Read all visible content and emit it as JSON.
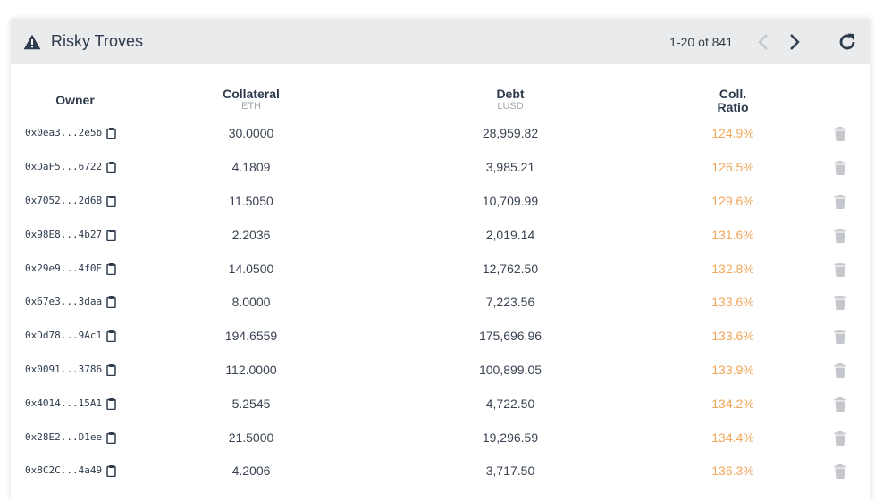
{
  "header": {
    "title": "Risky Troves",
    "pagination": "1-20 of 841"
  },
  "columns": {
    "owner": "Owner",
    "collateral": "Collateral",
    "collateral_unit": "ETH",
    "debt": "Debt",
    "debt_unit": "LUSD",
    "ratio_line1": "Coll.",
    "ratio_line2": "Ratio"
  },
  "rows": [
    {
      "owner": "0x0ea3...2e5b",
      "collateral": "30.0000",
      "debt": "28,959.82",
      "ratio": "124.9%"
    },
    {
      "owner": "0xDaF5...6722",
      "collateral": "4.1809",
      "debt": "3,985.21",
      "ratio": "126.5%"
    },
    {
      "owner": "0x7052...2d6B",
      "collateral": "11.5050",
      "debt": "10,709.99",
      "ratio": "129.6%"
    },
    {
      "owner": "0x98E8...4b27",
      "collateral": "2.2036",
      "debt": "2,019.14",
      "ratio": "131.6%"
    },
    {
      "owner": "0x29e9...4f0E",
      "collateral": "14.0500",
      "debt": "12,762.50",
      "ratio": "132.8%"
    },
    {
      "owner": "0x67e3...3daa",
      "collateral": "8.0000",
      "debt": "7,223.56",
      "ratio": "133.6%"
    },
    {
      "owner": "0xDd78...9Ac1",
      "collateral": "194.6559",
      "debt": "175,696.96",
      "ratio": "133.6%"
    },
    {
      "owner": "0x0091...3786",
      "collateral": "112.0000",
      "debt": "100,899.05",
      "ratio": "133.9%"
    },
    {
      "owner": "0x4014...15A1",
      "collateral": "5.2545",
      "debt": "4,722.50",
      "ratio": "134.2%"
    },
    {
      "owner": "0x28E2...D1ee",
      "collateral": "21.5000",
      "debt": "19,296.59",
      "ratio": "134.4%"
    },
    {
      "owner": "0x8C2C...4a49",
      "collateral": "4.2006",
      "debt": "3,717.50",
      "ratio": "136.3%"
    }
  ],
  "icons": {
    "title": "warning-icon",
    "prev": "chevron-left-icon",
    "next": "chevron-right-icon",
    "refresh": "refresh-icon",
    "copy": "clipboard-icon",
    "delete": "trash-icon"
  },
  "colors": {
    "ratio": "#f2a65a",
    "header_bg": "#eaebec",
    "icon_gray": "#c4c7cb"
  }
}
